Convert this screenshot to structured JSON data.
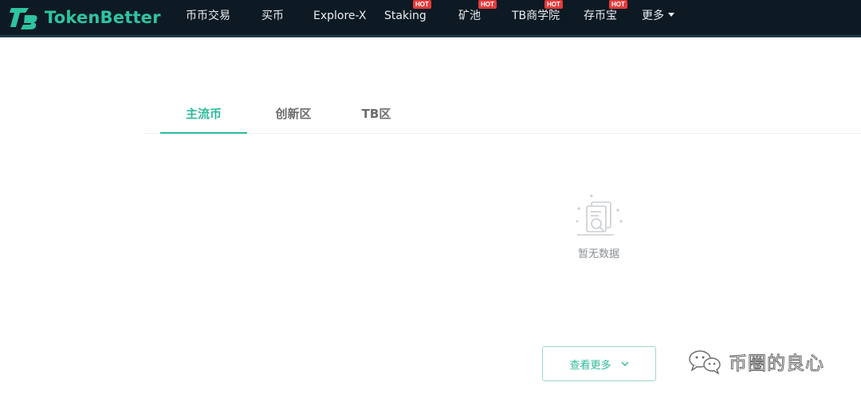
{
  "brand": {
    "name": "TokenBetter",
    "accent_color": "#2ec4a0",
    "nav_bg": "#0e1a23"
  },
  "nav": {
    "items": [
      {
        "label": "币币交易",
        "hot": false
      },
      {
        "label": "买币",
        "hot": false
      },
      {
        "label": "Explore-X",
        "hot": false
      },
      {
        "label": "Staking",
        "hot": true
      },
      {
        "label": "矿池",
        "hot": true
      },
      {
        "label": "TB商学院",
        "hot": true
      },
      {
        "label": "存币宝",
        "hot": true
      },
      {
        "label": "更多",
        "hot": false,
        "dropdown": true
      }
    ],
    "hot_badge": "HOT"
  },
  "tabs": [
    {
      "label": "主流币",
      "active": true
    },
    {
      "label": "创新区",
      "active": false
    },
    {
      "label": "TB区",
      "active": false
    }
  ],
  "empty_state": {
    "icon": "empty-document-search-icon",
    "text": "暂无数据"
  },
  "view_more": {
    "label": "查看更多",
    "icon": "chevron-down-icon"
  },
  "watermark": {
    "icon": "wechat-icon",
    "text": "币圈的良心"
  }
}
